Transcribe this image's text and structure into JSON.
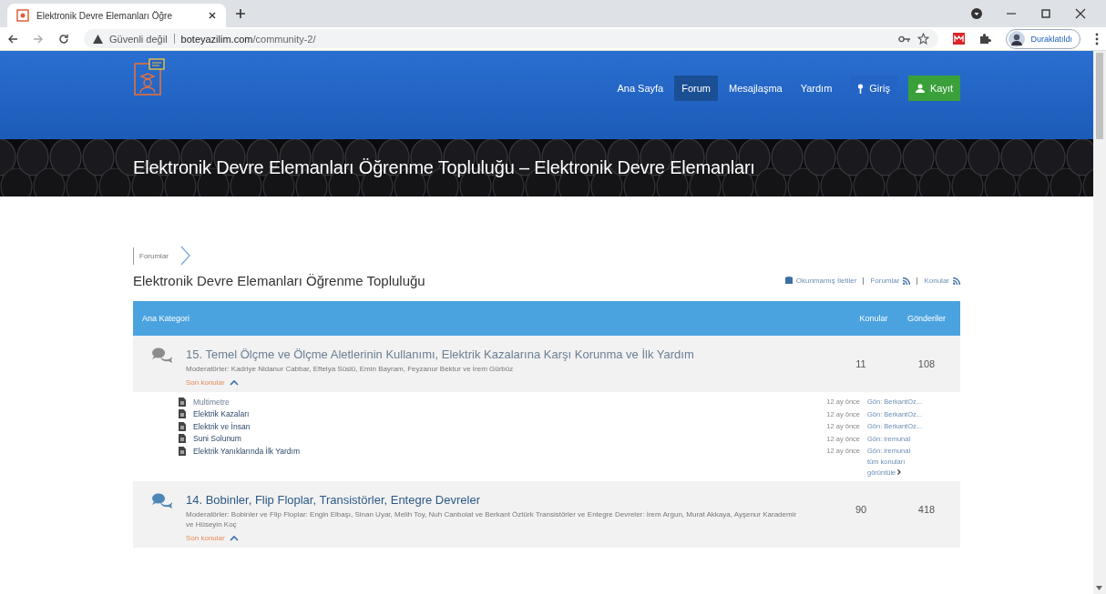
{
  "browser": {
    "tab_title": "Elektronik Devre Elemanları Öğre",
    "security": "Güvenli değil",
    "url_host": "boteyazilim.com",
    "url_path": "/community-2/",
    "profile": "Duraklatıldı"
  },
  "nav": [
    {
      "label": "Ana Sayfa",
      "kind": "link",
      "selected": false
    },
    {
      "label": "Forum",
      "kind": "link",
      "selected": true
    },
    {
      "label": "Mesajlaşma",
      "kind": "link",
      "selected": false
    },
    {
      "label": "Yardım",
      "kind": "link",
      "selected": false
    },
    {
      "label": "Giriş",
      "kind": "login",
      "selected": false
    },
    {
      "label": "Kayıt",
      "kind": "register",
      "selected": false
    }
  ],
  "banner_title": "Elektronik Devre Elemanları Öğrenme Topluluğu – Elektronik Devre Elemanları",
  "breadcrumb": [
    "Forumlar"
  ],
  "page_title": "Elektronik Devre Elemanları Öğrenme Topluluğu",
  "page_links": [
    "Okunmamış İletiler",
    "Forumlar",
    "Konular"
  ],
  "table": {
    "columns": [
      "Ana Kategori",
      "Konular",
      "Gönderiler"
    ],
    "forums": [
      {
        "title": "15. Temel Ölçme ve Ölçme Aletlerinin Kullanımı, Elektrik Kazalarına Karşı Korunma ve İlk Yardım",
        "moderators": "Moderatörler: Kadriye Nidanur Cabbar, Eftelya Süslü, Emin Bayram, Feyzanur Bektur ve İrem Gürbüz",
        "topics_count": "11",
        "posts_count": "108",
        "recent_label": "Son konular",
        "expanded": true,
        "read": true,
        "topics": [
          {
            "title": "Multimetre",
            "time": "12 ay önce",
            "author": "Gön: BerkantOz..."
          },
          {
            "title": "Elektrik Kazaları",
            "time": "12 ay önce",
            "author": "Gön: BerkantOz..."
          },
          {
            "title": "Elektrik ve İnsan",
            "time": "12 ay önce",
            "author": "Gön: BerkantOz..."
          },
          {
            "title": "Suni Solunum",
            "time": "12 ay önce",
            "author": "Gön: iremunal"
          },
          {
            "title": "Elektrik Yanıklarında İlk Yardım",
            "time": "12 ay önce",
            "author": "Gön: iremunal"
          }
        ],
        "all_topics_link": "tüm konuları görüntüle"
      },
      {
        "title": "14. Bobinler, Flip Floplar, Transistörler, Entegre Devreler",
        "moderators": "Moderatörler: Bobinler ve Flip Floplar: Engin Elbaşı, Sinan Uyar, Melih Toy, Nuh Canbolat ve Berkant Öztürk Transistörler ve Entegre Devreler: İrem Argun, Murat Akkaya, Ayşenur Karademir ve Hüseyin Koç",
        "topics_count": "90",
        "posts_count": "418",
        "recent_label": "Son konular",
        "expanded": true,
        "read": false
      }
    ]
  }
}
